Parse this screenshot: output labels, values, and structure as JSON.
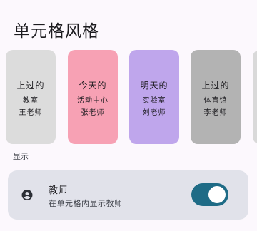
{
  "header": {
    "title": "单元格风格"
  },
  "cards": [
    {
      "line1": "上过的",
      "line2": "教室",
      "line3": "王老师",
      "bg": "#dcdcdc"
    },
    {
      "line1": "今天的",
      "line2": "活动中心",
      "line3": "张老师",
      "bg": "#f7a1b4"
    },
    {
      "line1": "明天的",
      "line2": "实验室",
      "line3": "刘老师",
      "bg": "#bfa6ec"
    },
    {
      "line1": "上过的",
      "line2": "体育馆",
      "line3": "李老师",
      "bg": "#b3b3b3"
    }
  ],
  "display_section": {
    "label": "显示",
    "show_teacher": {
      "icon": "account-circle-icon",
      "title": "教师",
      "subtitle": "在单元格内显示教师",
      "enabled": true
    }
  }
}
